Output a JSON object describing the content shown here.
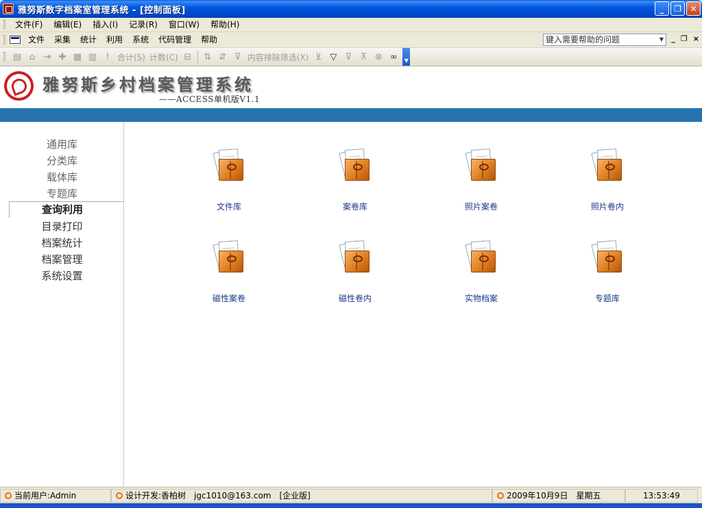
{
  "window": {
    "title": "雅努斯数字档案室管理系统 - [控制面板]",
    "buttons": {
      "minimize": "_",
      "restore": "❐",
      "close": "✕"
    }
  },
  "menubar1": {
    "items": [
      "文件(F)",
      "编辑(E)",
      "插入(I)",
      "记录(R)",
      "窗口(W)",
      "帮助(H)"
    ]
  },
  "menubar2": {
    "items": [
      "文件",
      "采集",
      "统计",
      "利用",
      "系统",
      "代码管理",
      "帮助"
    ],
    "help_placeholder": "键入需要帮助的问题",
    "child_controls": [
      "_",
      "❐",
      "×"
    ]
  },
  "toolbar": {
    "sum_label": "合计(S)",
    "count_label": "计数(C)",
    "filter_label": "内容排除筛选(X)"
  },
  "banner": {
    "title": "雅努斯乡村档案管理系统",
    "subtitle": "——ACCESS单机版V1.1"
  },
  "sidebar": {
    "items": [
      "通用库",
      "分类库",
      "载体库",
      "专题库",
      "查询利用",
      "目录打印",
      "档案统计",
      "档案管理",
      "系统设置"
    ]
  },
  "tiles": [
    "文件库",
    "案卷库",
    "照片案卷",
    "照片卷内",
    "磁性案卷",
    "磁性卷内",
    "实物档案",
    "专题库"
  ],
  "statusbar": {
    "user": "当前用户:Admin",
    "developer": "设计开发:香柏树　jgc1010@163.com　[企业版]",
    "date": "2009年10月9日　星期五",
    "time": "13:53:49"
  },
  "colors": {
    "title_bar": "#0058e0",
    "blue_band": "#2574b0",
    "logo_red": "#cc1f1f",
    "tile_label": "#1a3a8a"
  }
}
